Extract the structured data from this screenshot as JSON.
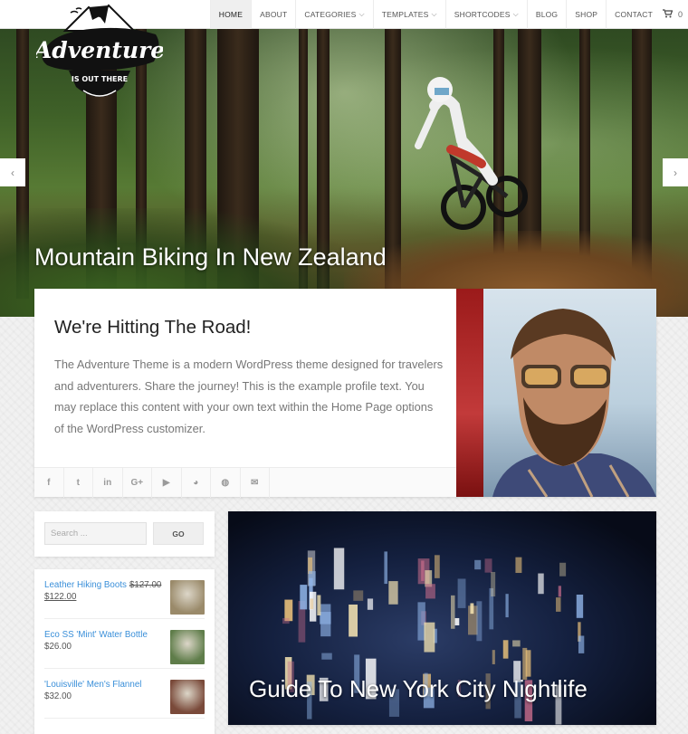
{
  "nav": {
    "items": [
      {
        "label": "HOME",
        "dropdown": false,
        "active": true
      },
      {
        "label": "ABOUT",
        "dropdown": false,
        "active": false
      },
      {
        "label": "CATEGORIES",
        "dropdown": true,
        "active": false
      },
      {
        "label": "TEMPLATES",
        "dropdown": true,
        "active": false
      },
      {
        "label": "SHORTCODES",
        "dropdown": true,
        "active": false
      },
      {
        "label": "BLOG",
        "dropdown": false,
        "active": false
      },
      {
        "label": "SHOP",
        "dropdown": false,
        "active": false
      },
      {
        "label": "CONTACT",
        "dropdown": false,
        "active": false
      }
    ],
    "cart_count": "0",
    "cart_icon": "shopping-cart-icon"
  },
  "logo": {
    "word": "Adventure",
    "tagline": "IS OUT THERE"
  },
  "hero": {
    "title": "Mountain Biking In New Zealand",
    "prev_icon": "chevron-left-icon",
    "next_icon": "chevron-right-icon"
  },
  "profile": {
    "heading": "We're Hitting The Road!",
    "text": "The Adventure Theme is a modern WordPress theme designed for travelers and adventurers. Share the journey! This is the example profile text. You may replace this content with your own text within the Home Page options of the WordPress customizer.",
    "social": [
      {
        "name": "facebook",
        "glyph": "f"
      },
      {
        "name": "twitter",
        "glyph": "t"
      },
      {
        "name": "linkedin",
        "glyph": "in"
      },
      {
        "name": "google-plus",
        "glyph": "G+"
      },
      {
        "name": "youtube",
        "glyph": "▶"
      },
      {
        "name": "github",
        "glyph": "◕"
      },
      {
        "name": "dribbble",
        "glyph": "◍"
      },
      {
        "name": "email",
        "glyph": "✉"
      }
    ]
  },
  "search": {
    "placeholder": "Search ...",
    "button_label": "GO"
  },
  "products": [
    {
      "name": "Leather Hiking Boots",
      "old_price": "$127.00",
      "price": "$122.00",
      "on_sale": true,
      "thumb_color": "#9a8a6a"
    },
    {
      "name": "Eco SS 'Mint' Water Bottle",
      "old_price": "",
      "price": "$26.00",
      "on_sale": false,
      "thumb_color": "#5f7d4a"
    },
    {
      "name": "'Louisville' Men's Flannel",
      "old_price": "",
      "price": "$32.00",
      "on_sale": false,
      "thumb_color": "#7a4a3a"
    }
  ],
  "post": {
    "title": "Guide To New York City Nightlife"
  }
}
